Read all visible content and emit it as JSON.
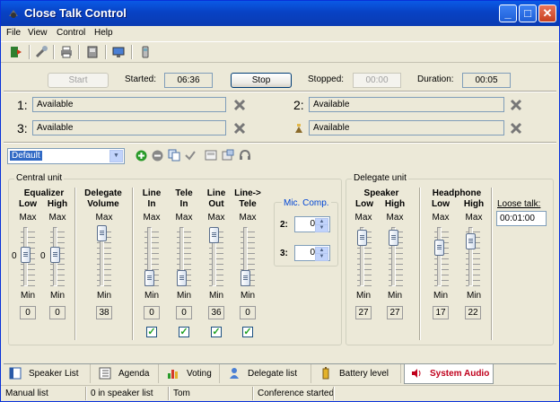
{
  "window": {
    "title": "Close Talk Control"
  },
  "menu": [
    "File",
    "View",
    "Control",
    "Help"
  ],
  "controls": {
    "start_label": "Start",
    "started_label": "Started:",
    "started_value": "06:36",
    "stop_label": "Stop",
    "stopped_label": "Stopped:",
    "stopped_value": "00:00",
    "duration_label": "Duration:",
    "duration_value": "00:05"
  },
  "channels": [
    {
      "number": "1:",
      "status": "Available"
    },
    {
      "number": "2:",
      "status": "Available"
    },
    {
      "number": "3:",
      "status": "Available"
    },
    {
      "number": "",
      "status": "Available"
    }
  ],
  "preset": {
    "selected": "Default"
  },
  "central_unit": {
    "title": "Central unit",
    "max_label": "Max",
    "min_label": "Min",
    "equalizer": {
      "title": "Equalizer",
      "low": "Low",
      "high": "High",
      "low_value": "0",
      "high_value": "0"
    },
    "delegate_volume": {
      "title1": "Delegate",
      "title2": "Volume",
      "value": "38"
    },
    "line_in": {
      "title1": "Line",
      "title2": "In",
      "value": "0"
    },
    "tele_in": {
      "title1": "Tele",
      "title2": "In",
      "value": "0"
    },
    "line_out": {
      "title1": "Line",
      "title2": "Out",
      "value": "36"
    },
    "line_tele": {
      "title1": "Line->",
      "title2": "Tele",
      "value": "0"
    }
  },
  "mic_comp": {
    "title": "Mic. Comp.",
    "row2_label": "2:",
    "row2_value": "0",
    "row3_label": "3:",
    "row3_value": "0"
  },
  "delegate_unit": {
    "title": "Delegate unit",
    "speaker": {
      "title": "Speaker",
      "low": "Low",
      "high": "High",
      "low_value": "27",
      "high_value": "27"
    },
    "headphone": {
      "title": "Headphone",
      "low": "Low",
      "high": "High",
      "low_value": "17",
      "high_value": "22"
    }
  },
  "loose_talk": {
    "label": "Loose talk:",
    "value": "00:01:00"
  },
  "tabs": [
    {
      "label": "Speaker List",
      "icon": "speaker-list-icon"
    },
    {
      "label": "Agenda",
      "icon": "agenda-icon"
    },
    {
      "label": "Voting",
      "icon": "voting-icon"
    },
    {
      "label": "Delegate list",
      "icon": "delegate-list-icon"
    },
    {
      "label": "Battery level",
      "icon": "battery-icon"
    },
    {
      "label": "System Audio",
      "icon": "audio-icon"
    }
  ],
  "status_bar": [
    "Manual list",
    "0 in speaker list",
    "Tom",
    "Conference started"
  ],
  "colors": {
    "title_bar": "#0842c4",
    "active_tab": "#c0001c",
    "checkbox": "#21a121",
    "add_icon": "#2a9b2a"
  }
}
